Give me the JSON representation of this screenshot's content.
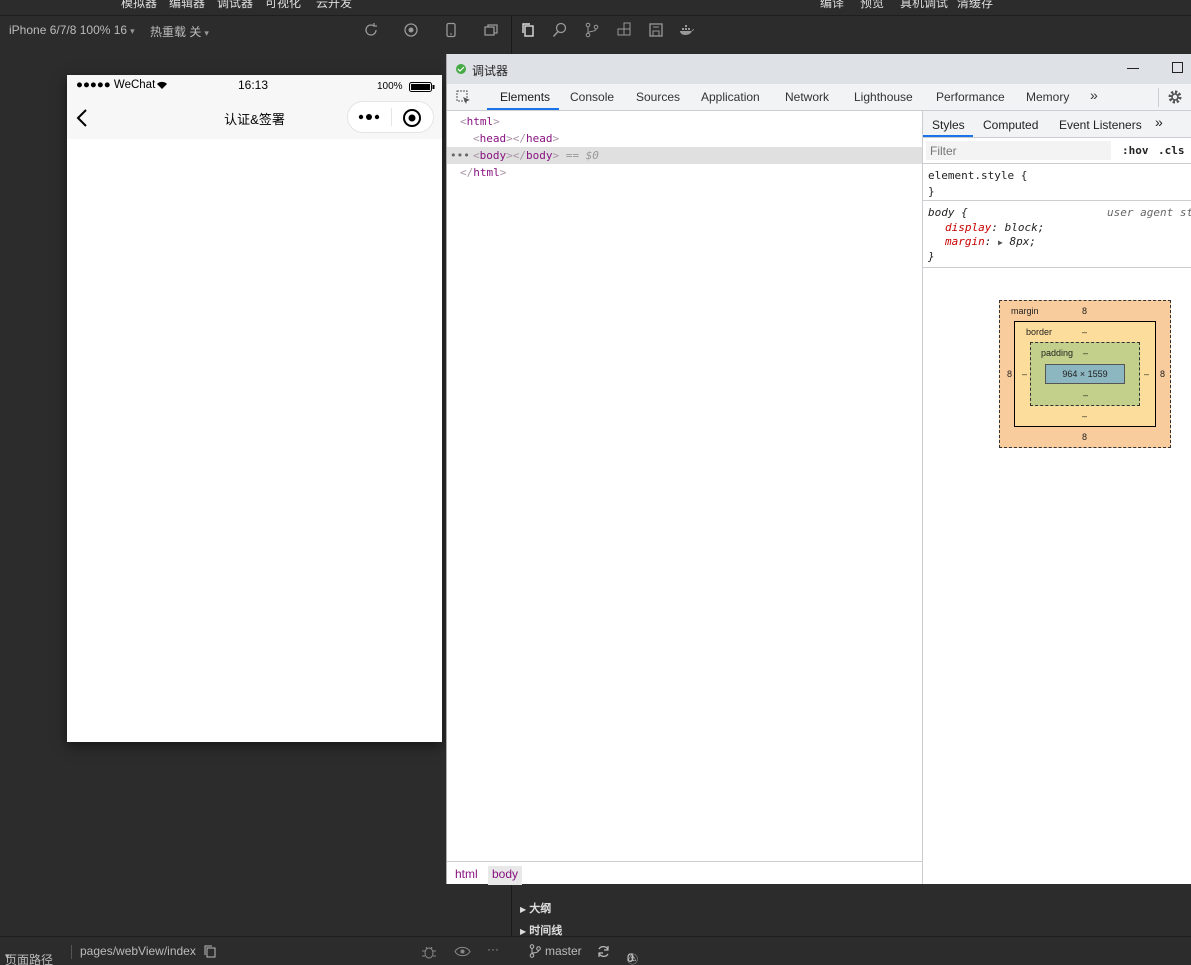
{
  "topmenu": {
    "items": [
      "模拟器",
      "编辑器",
      "调试器",
      "可视化",
      "云开发"
    ],
    "right": [
      "编译",
      "预览",
      "真机调试",
      "清缓存"
    ]
  },
  "toolbar": {
    "device": "iPhone 6/7/8 100% 16",
    "hotreload": "热重载 关"
  },
  "phone": {
    "carrier": "●●●●● WeChat",
    "time": "16:13",
    "battery": "100%",
    "title": "认证&签署"
  },
  "devtools": {
    "title": "调试器",
    "tabs": [
      "Elements",
      "Console",
      "Sources",
      "Application",
      "Network",
      "Lighthouse",
      "Performance",
      "Memory"
    ],
    "dom": {
      "l1": "html",
      "l2": "head",
      "l3": "body",
      "l3_suffix": "== $0",
      "l4": "html"
    },
    "breadcrumbs": [
      "html",
      "body"
    ],
    "styles": {
      "tabs": [
        "Styles",
        "Computed",
        "Event Listeners"
      ],
      "filter_placeholder": "Filter",
      "hov": ":hov",
      "cls": ".cls",
      "element_style": "element.style {",
      "close": "}",
      "body_selector": "body {",
      "ua": "user agent st",
      "prop1": "display",
      "val1": "block;",
      "prop2": "margin",
      "val2": "8px;"
    },
    "boxmodel": {
      "margin": "margin",
      "border": "border",
      "padding": "padding",
      "content": "964 × 1559",
      "m": "8",
      "dash": "–"
    }
  },
  "outline": {
    "items": [
      "大纲",
      "时间线"
    ]
  },
  "statusbar": {
    "path_label": "页面路径",
    "path": "pages/webView/index",
    "branch": "master",
    "errors": "0",
    "warnings": "0"
  }
}
